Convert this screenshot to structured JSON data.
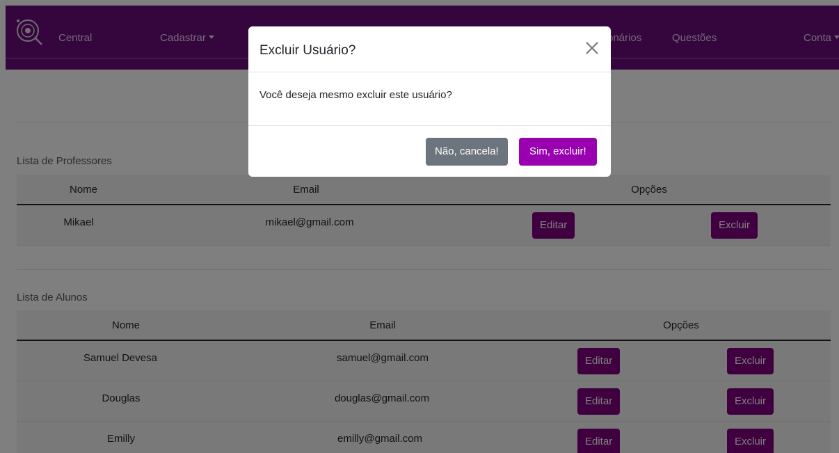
{
  "navbar": {
    "brand": "Central",
    "items": [
      {
        "label": "Cadastrar",
        "dropdown": true
      },
      {
        "label": "onários",
        "dropdown": false
      },
      {
        "label": "Questões",
        "dropdown": false
      },
      {
        "label": "Conta",
        "dropdown": true
      }
    ],
    "background": "#6a0d7a"
  },
  "professores": {
    "title": "Lista de Professores",
    "headers": [
      "Nome",
      "Email",
      "Opções"
    ],
    "rows": [
      {
        "nome": "Mikael",
        "email": "mikael@gmail.com",
        "edit": "Editar",
        "delete": "Excluir"
      }
    ]
  },
  "alunos": {
    "title": "Lista de Alunos",
    "headers": [
      "Nome",
      "Email",
      "Opções"
    ],
    "rows": [
      {
        "nome": "Samuel Devesa",
        "email": "samuel@gmail.com",
        "edit": "Editar",
        "delete": "Excluir"
      },
      {
        "nome": "Douglas",
        "email": "douglas@gmail.com",
        "edit": "Editar",
        "delete": "Excluir"
      },
      {
        "nome": "Emilly",
        "email": "emilly@gmail.com",
        "edit": "Editar",
        "delete": "Excluir"
      }
    ]
  },
  "modal": {
    "title": "Excluir Usuário?",
    "body": "Você deseja mesmo excluir este usuário?",
    "cancel_label": "Não, cancela!",
    "confirm_label": "Sim, excluir!",
    "close_icon": "close-icon"
  },
  "colors": {
    "brand_purple": "#800080",
    "confirm_purple": "#9800b0",
    "cancel_gray": "#6c757d"
  }
}
